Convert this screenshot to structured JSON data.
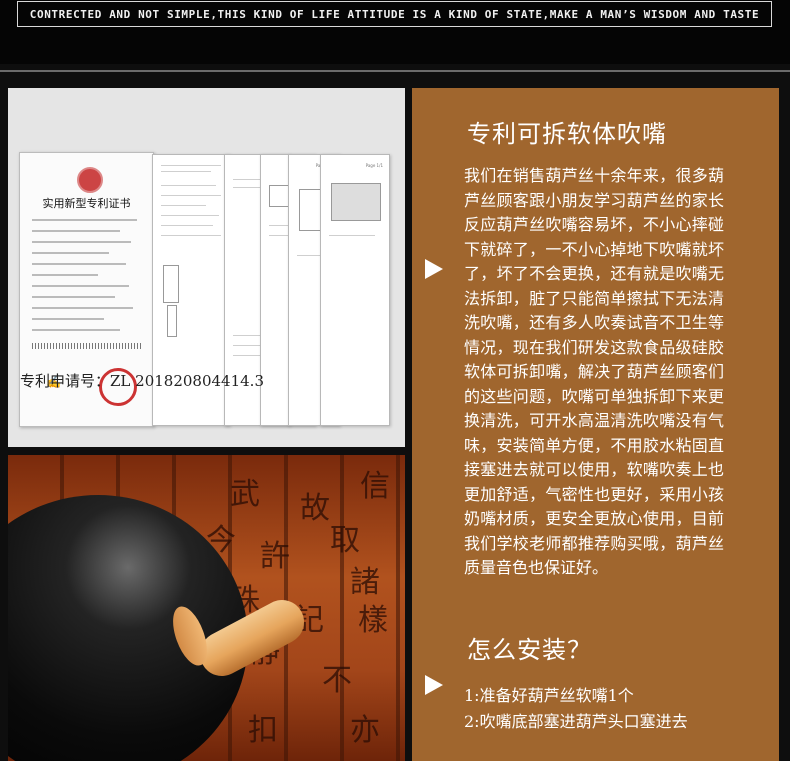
{
  "banner": {
    "text": "CONTRECTED AND NOT SIMPLE,THIS KIND OF LIFE ATTITUDE IS A KIND OF STATE,MAKE A MAN’S WISDOM AND TASTE"
  },
  "certificate": {
    "doc_title": "实用新型专利证书",
    "patent_number_text": "专利申请号：ZL 201820804414.3",
    "page_labels": [
      "Page 1/1",
      "Page 1/1",
      "Page 1/1",
      "Page 1/1"
    ]
  },
  "photo": {
    "glyphs": [
      "武",
      "故",
      "取",
      "信",
      "諸",
      "樣",
      "今",
      "許",
      "記",
      "珠",
      "静",
      "不",
      "扣",
      "亦"
    ]
  },
  "intro": {
    "title": "专利可拆软体吹嘴",
    "body": "我们在销售葫芦丝十余年来，很多葫芦丝顾客跟小朋友学习葫芦丝的家长反应葫芦丝吹嘴容易坏，不小心摔碰下就碎了，一不小心掉地下吹嘴就坏了，坏了不会更换，还有就是吹嘴无法拆卸，脏了只能简单擦拭下无法清洗吹嘴，还有多人吹奏试音不卫生等情况，现在我们研发这款食品级硅胶软体可拆卸嘴，解决了葫芦丝顾客们的这些问题，吹嘴可单独拆卸下来更换清洗，可开水高温清洗吹嘴没有气味，安装简单方便，不用胶水粘固直接塞进去就可以使用，软嘴吹奏上也更加舒适，气密性也更好，采用小孩奶嘴材质，更安全更放心使用，目前我们学校老师都推荐购买哦，葫芦丝质量音色也保证好。"
  },
  "install": {
    "title": "怎么安装？",
    "steps": [
      "1:准备好葫芦丝软嘴1个",
      "2:吹嘴底部塞进葫芦头口塞进去"
    ]
  },
  "colors": {
    "text_panel": "#a0662e",
    "background": "#0e0e0e",
    "certificate_panel": "#e5e5e5"
  }
}
